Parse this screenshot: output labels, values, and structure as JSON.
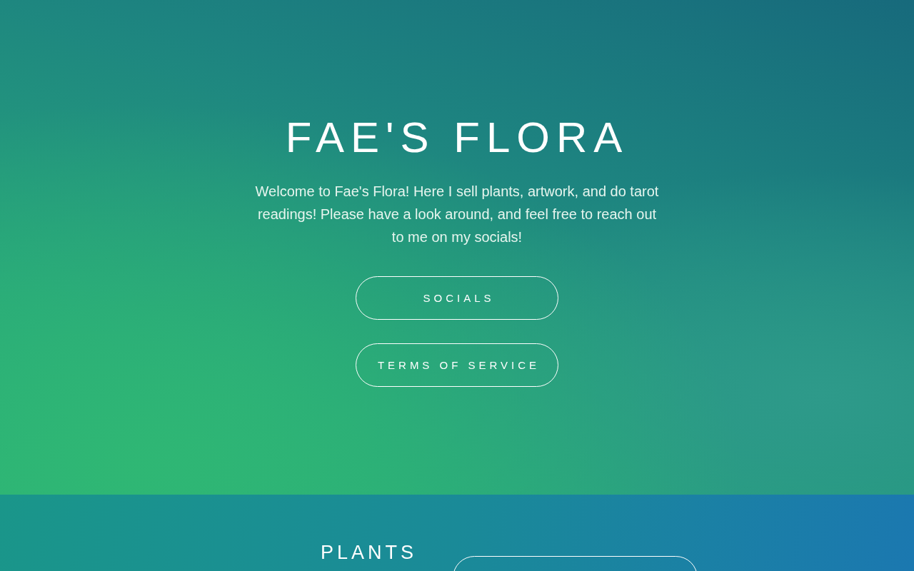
{
  "hero": {
    "title": "FAE'S FLORA",
    "intro": "Welcome to Fae's Flora! Here I sell plants, artwork, and do tarot readings! Please have a look around, and feel free to reach out to me on my socials!",
    "buttons": [
      "SOCIALS",
      "TERMS OF SERVICE"
    ]
  },
  "section": {
    "heading": "PLANTS"
  }
}
